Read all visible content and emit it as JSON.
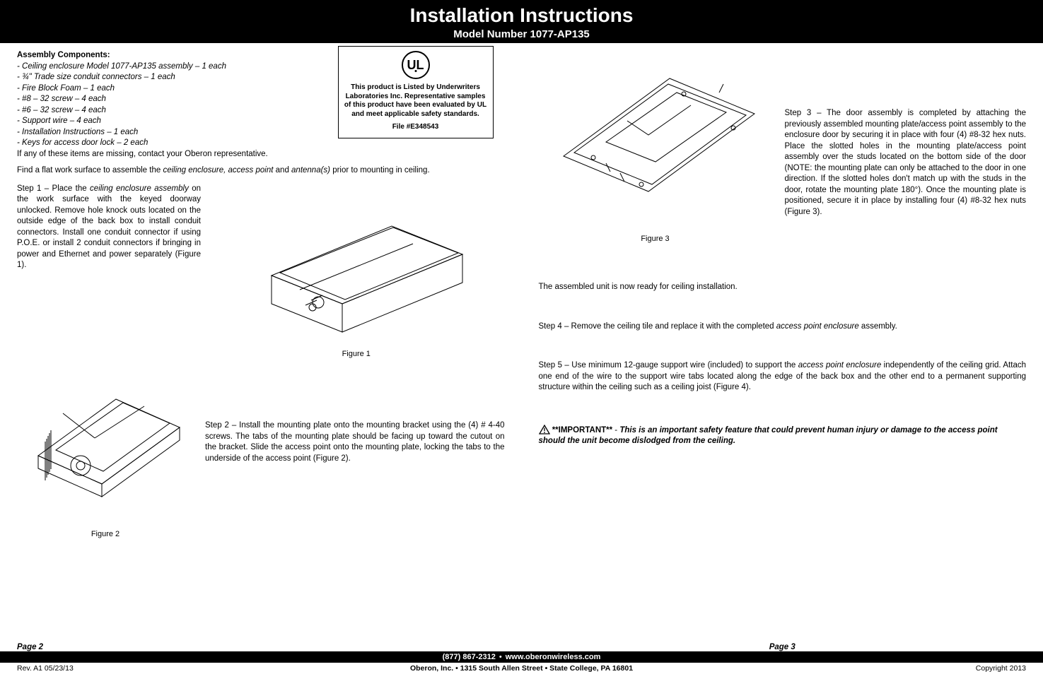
{
  "banner": {
    "title": "Installation Instructions",
    "subtitle": "Model Number 1077-AP135"
  },
  "left": {
    "assembly_heading": "Assembly Components:",
    "components": [
      "- Ceiling enclosure Model 1077-AP135 assembly – 1 each",
      "- ¾\" Trade size conduit connectors – 1 each",
      "- Fire Block Foam – 1 each",
      "- #8 – 32 screw – 4 each",
      "- #6 – 32 screw – 4 each",
      "- Support wire – 4 each",
      "- Installation Instructions – 1 each",
      "- Keys for access door lock – 2 each"
    ],
    "components_note": "If any of these items are missing, contact your Oberon representative.",
    "flat_surface_pre": "Find a flat work surface to assemble the ",
    "flat_surface_em1": "ceiling enclosure, access point",
    "flat_surface_mid": " and ",
    "flat_surface_em2": "antenna(s)",
    "flat_surface_post": " prior to mounting in ceiling.",
    "step1_pre": "Step 1 – Place the ",
    "step1_em": "ceiling enclosure assembly",
    "step1_post": " on the work surface with the keyed doorway unlocked. Remove hole knock outs located on the outside edge of the back box to install conduit connectors. Install one conduit connector if using P.O.E. or install 2 conduit connectors if bringing in power and Ethernet and power separately (Figure 1).",
    "figure1_label": "Figure 1",
    "step2": "Step 2 – Install the mounting plate onto the mounting bracket using the (4) # 4-40 screws. The tabs of the mounting plate should be facing up toward the cutout on the bracket. Slide the access point onto the mounting plate, locking the tabs to the underside of the access point (Figure 2).",
    "figure2_label": "Figure 2"
  },
  "ul_box": {
    "logo_text": "UL",
    "line1": "This product is Listed by Underwriters Laboratories Inc. Representative samples of this product have been evaluated by UL and meet applicable safety standards.",
    "file": "File #E348543"
  },
  "right": {
    "step3": "Step 3 – The door assembly is completed by attaching the previously assembled mounting plate/access point assembly to the enclosure door by securing it in place with four (4) #8-32 hex nuts. Place the slotted holes in the mounting plate/access point assembly over the studs located on the bottom side of the door (NOTE: the mounting plate can only be attached to the door in one direction. If the slotted holes don't match up with the studs in the door, rotate the mounting plate 180°). Once the mounting plate is positioned, secure it in place by installing four (4) #8-32 hex nuts (Figure 3).",
    "figure3_label": "Figure 3",
    "assembled": "The assembled unit is now ready for ceiling installation.",
    "step4_pre": "Step 4 – Remove the ceiling tile and replace it with the completed ",
    "step4_em": "access point enclosure",
    "step4_post": " assembly.",
    "step5_pre": "Step 5 – Use minimum 12-gauge support wire (included) to support the ",
    "step5_em": "access point enclosure",
    "step5_post": " independently of the ceiling grid. Attach one end of the wire to the support wire tabs located along the edge of the back box and the other end to a permanent supporting structure within the ceiling such as a ceiling joist (Figure 4).",
    "important_label": "**IMPORTANT**",
    "important_dash": " - ",
    "important_body": "This is an important safety feature that could prevent human injury or damage to the access point should the unit become dislodged from the ceiling."
  },
  "footer": {
    "page_left": "Page 2",
    "page_right": "Page 3",
    "phone": "(877) 867-2312",
    "site": "www.oberonwireless.com",
    "rev": "Rev. A1 05/23/13",
    "company": "Oberon, Inc.",
    "addr1": "1315 South Allen Street",
    "addr2": "State College, PA 16801",
    "copyright": "Copyright 2013"
  }
}
